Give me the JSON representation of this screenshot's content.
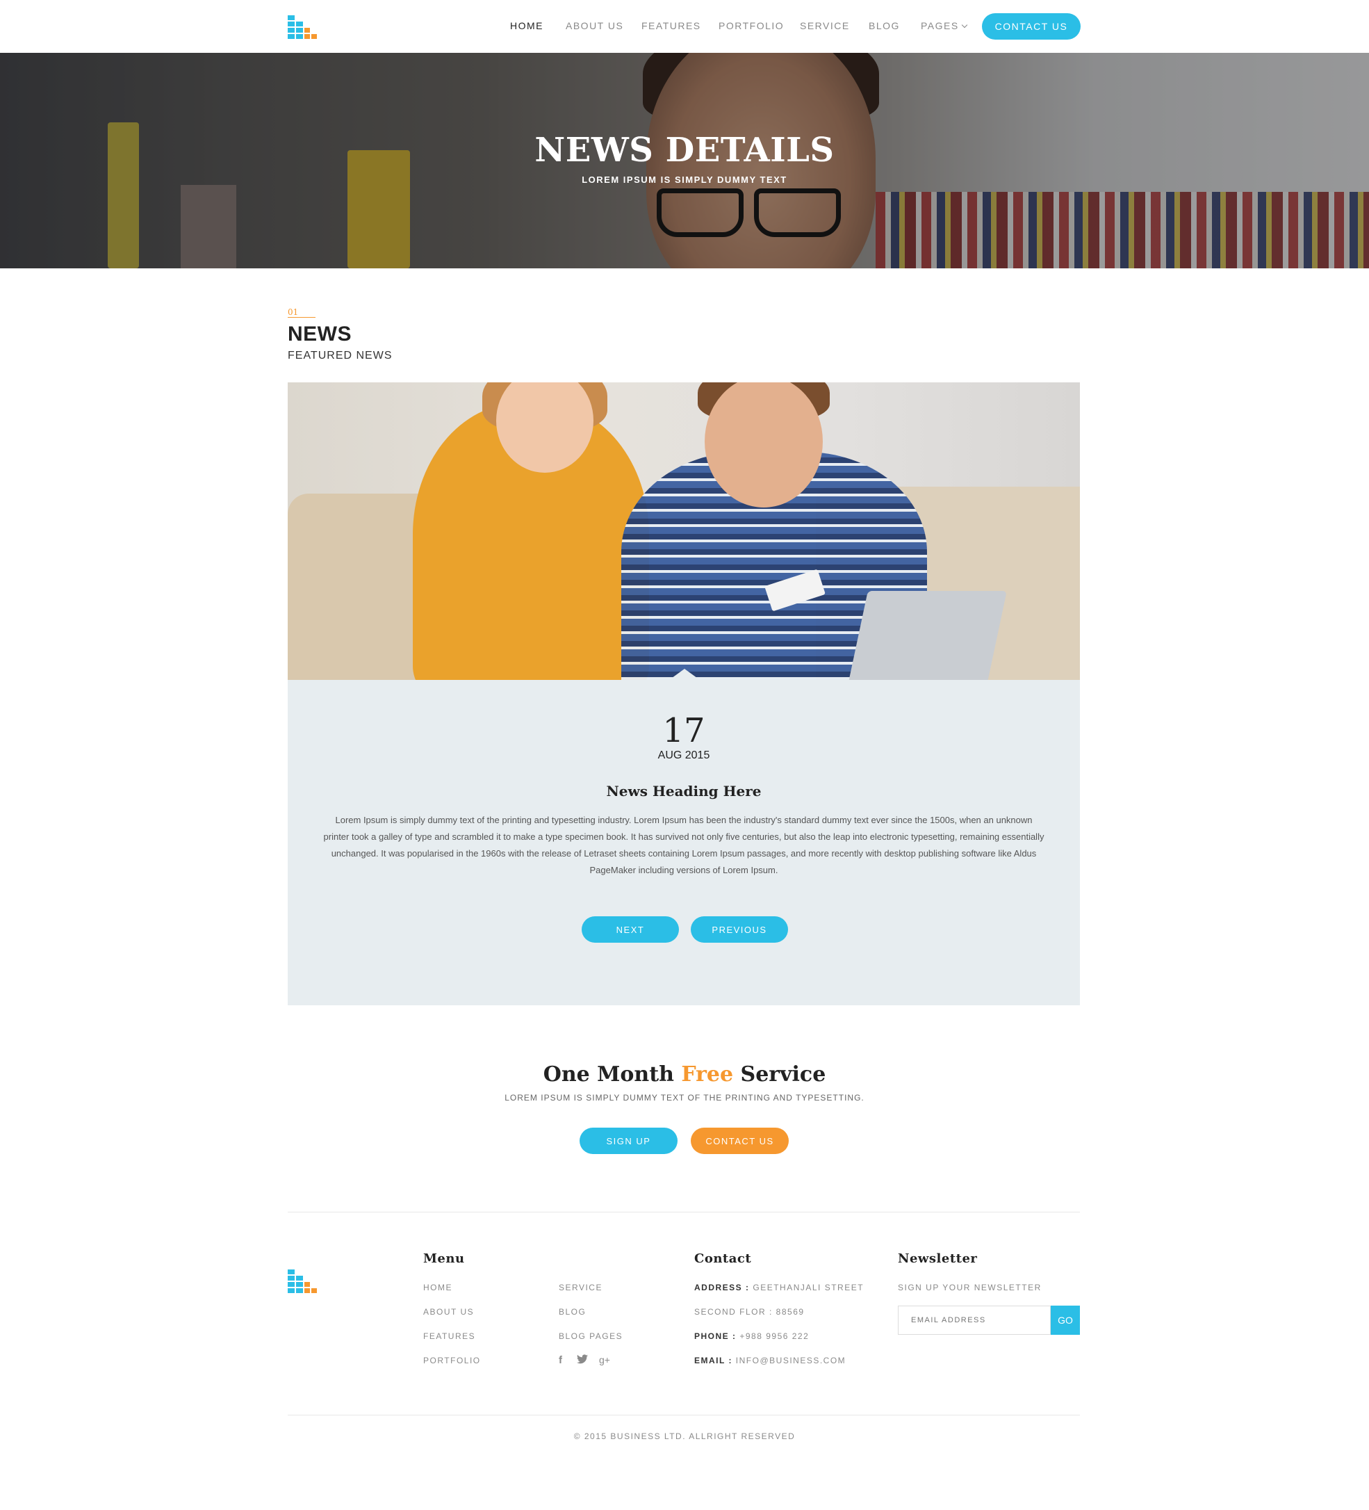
{
  "colors": {
    "accent_blue": "#2bbee6",
    "accent_orange": "#f6982f",
    "box_bg": "#e7edf0"
  },
  "header": {
    "logo_icon": "bars-logo-icon",
    "nav": [
      {
        "label": "HOME",
        "active": true
      },
      {
        "label": "ABOUT US"
      },
      {
        "label": "FEATURES"
      },
      {
        "label": "PORTFOLIO"
      },
      {
        "label": "SERVICE"
      },
      {
        "label": "BLOG"
      },
      {
        "label": "PAGES",
        "icon": "chevron-down-icon"
      }
    ],
    "contact_button": "CONTACT US"
  },
  "hero": {
    "title": "NEWS DETAILS",
    "subtitle": "LOREM IPSUM IS SIMPLY DUMMY TEXT"
  },
  "section": {
    "number": "01",
    "title": "NEWS",
    "subtitle": "FEATURED NEWS"
  },
  "news": {
    "day": "17",
    "month_year": "AUG 2015",
    "heading": "News Heading Here",
    "body": "Lorem Ipsum is simply dummy text of the printing and typesetting industry. Lorem Ipsum has been the industry's standard dummy text ever since the 1500s, when an unknown printer took a galley of type and scrambled it to make a type specimen book. It has survived not only five centuries, but also the leap into electronic typesetting, remaining essentially unchanged. It was popularised in the 1960s with the release of Letraset sheets containing Lorem Ipsum passages, and more recently with desktop publishing software like Aldus PageMaker including versions of Lorem Ipsum.",
    "next_label": "NEXT",
    "previous_label": "PREVIOUS"
  },
  "cta": {
    "title_pre": "One Month ",
    "title_accent": "Free",
    "title_post": " Service",
    "subtitle": "LOREM IPSUM IS SIMPLY DUMMY TEXT OF THE PRINTING AND TYPESETTING.",
    "signup_label": "SIGN UP",
    "contact_label": "CONTACT US"
  },
  "footer": {
    "menu_title": "Menu",
    "menu_col1": [
      "HOME",
      "ABOUT US",
      "FEATURES",
      "PORTFOLIO"
    ],
    "menu_col2": [
      "SERVICE",
      "BLOG",
      "BLOG PAGES"
    ],
    "social_icons": [
      "facebook-icon",
      "twitter-icon",
      "google-plus-icon"
    ],
    "contact_title": "Contact",
    "contact": {
      "address_label": "ADDRESS :",
      "address_value": "GEETHANJALI STREET",
      "address_line2": "SECOND FLOR : 88569",
      "phone_label": "PHONE :",
      "phone_value": "+988 9956 222",
      "email_label": "EMAIL :",
      "email_value": "INFO@BUSINESS.COM"
    },
    "newsletter_title": "Newsletter",
    "newsletter_text": "SIGN UP YOUR NEWSLETTER",
    "email_placeholder": "EMAIL ADDRESS",
    "go_label": "GO",
    "copyright": "© 2015 BUSINESS LTD. ALLRIGHT RESERVED"
  }
}
